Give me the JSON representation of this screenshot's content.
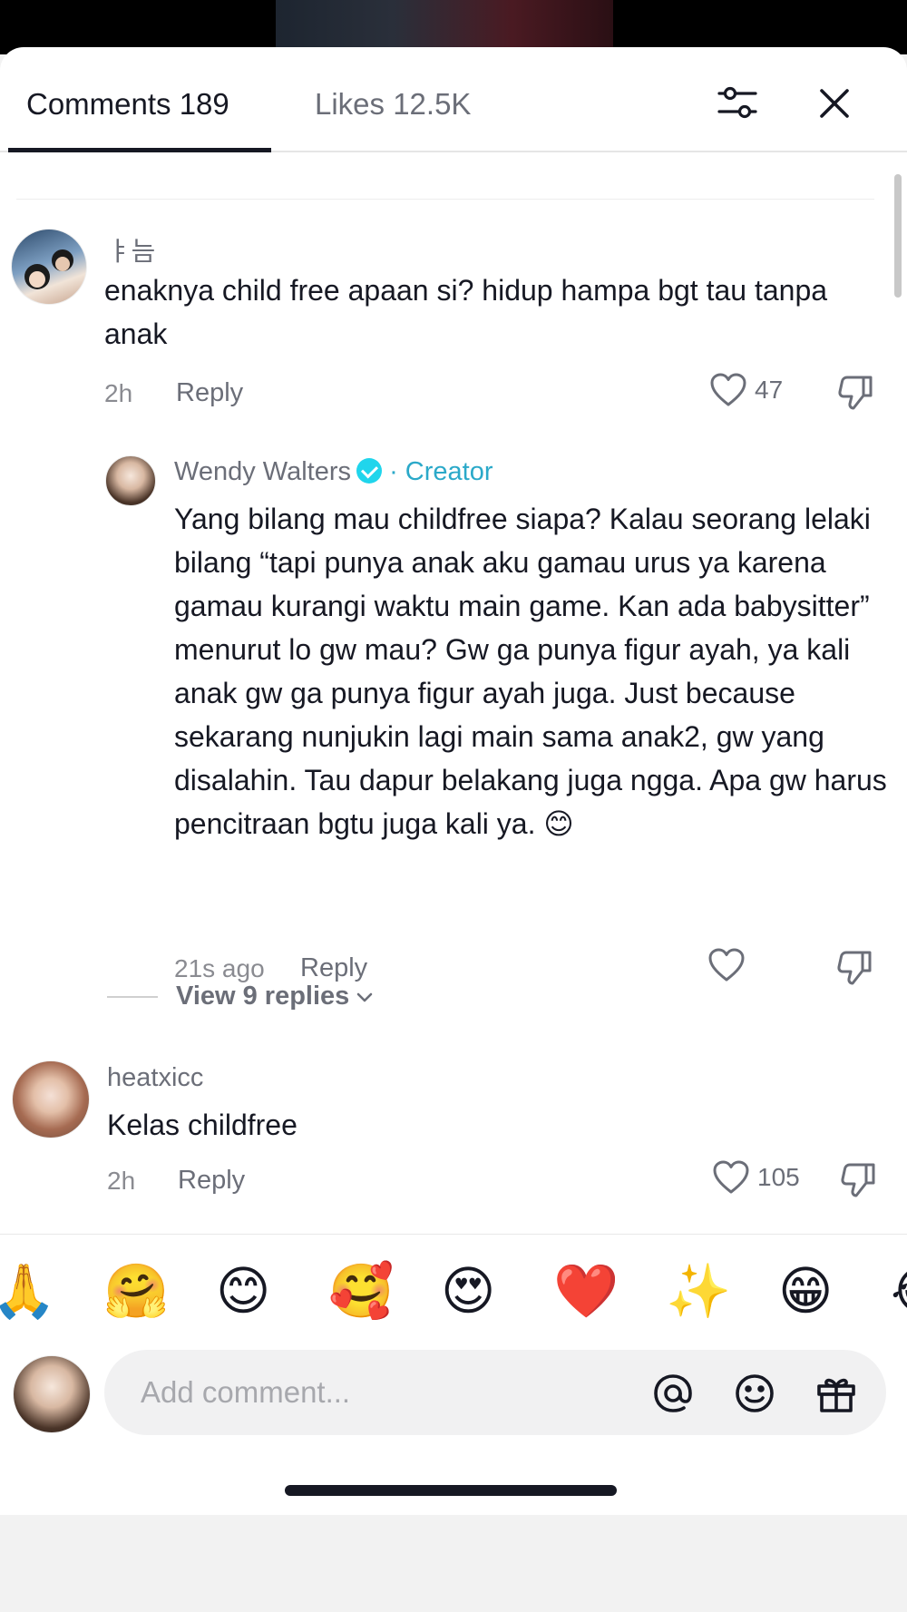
{
  "header": {
    "comments_tab": "Comments 189",
    "likes_tab": "Likes 12.5K"
  },
  "comments": [
    {
      "username": "ㅑ늠",
      "text": "enaknya child free apaan si? hidup hampa bgt tau tanpa anak",
      "time": "2h",
      "reply_label": "Reply",
      "likes": "47"
    },
    {
      "username": "Wendy Walters",
      "badge": "· Creator",
      "text": "Yang bilang mau childfree siapa? Kalau seorang lelaki bilang “tapi punya anak aku gamau urus ya karena gamau kurangi waktu main game. Kan ada babysitter” menurut lo gw mau? Gw ga punya figur ayah, ya kali anak gw ga punya figur ayah juga. Just because sekarang nunjukin lagi main sama anak2, gw yang disalahin. Tau dapur belakang juga ngga. Apa gw harus pencitraan bgtu juga kali ya. 😊",
      "time": "21s ago",
      "reply_label": "Reply",
      "likes": ""
    },
    {
      "username": "heatxicc",
      "text": "Kelas childfree",
      "time": "2h",
      "reply_label": "Reply",
      "likes": "105"
    }
  ],
  "view_replies": "View 9 replies",
  "emoji_bar": [
    "🙏",
    "🤗",
    "😊",
    "🥰",
    "😍",
    "❤️",
    "✨",
    "😁",
    "😂"
  ],
  "composer": {
    "placeholder": "Add comment..."
  },
  "icons": {
    "filter": "filter-sliders-icon",
    "close": "close-icon",
    "like": "heart-icon",
    "dislike": "thumbs-down-icon",
    "mention": "at-sign-icon",
    "emoji": "smiley-icon",
    "gift": "gift-icon"
  },
  "colors": {
    "accent_creator": "#2ba9c9",
    "verified": "#20d5ec",
    "text_primary": "#161823",
    "text_secondary": "#6b6e78"
  }
}
